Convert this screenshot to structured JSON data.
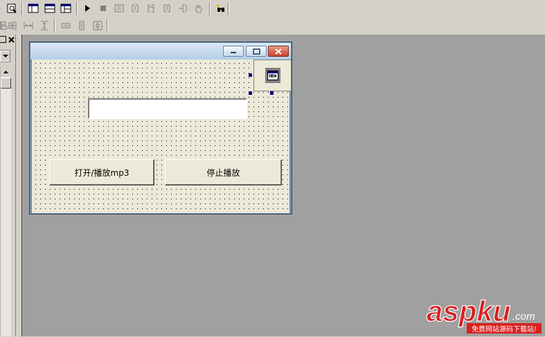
{
  "toolbar1": {
    "icons": [
      "find-icon",
      "form-layout-icon",
      "form-view-icon",
      "form-tree-icon",
      "run-icon",
      "stop-icon",
      "step-icon",
      "step-into-icon",
      "step-over-icon",
      "step-out-icon",
      "run-to-cursor-icon",
      "hand-icon",
      "debug-tool-icon"
    ]
  },
  "toolbar2": {
    "icons": [
      "align-left-icon",
      "align-center-icon",
      "space-horizontal-icon",
      "space-vertical-icon",
      "make-same-width-icon",
      "make-same-height-icon",
      "center-in-form-icon"
    ]
  },
  "form": {
    "text_input_value": "",
    "open_button_label": "打开/播放mp3",
    "stop_button_label": "停止播放"
  },
  "watermark": {
    "brand": "aspku",
    "suffix": ".com",
    "tagline": "免费网站源码下载站!"
  },
  "colors": {
    "workspace": "#a0a0a0",
    "brand_red": "#d82020",
    "tagline_bg": "#d82020"
  }
}
